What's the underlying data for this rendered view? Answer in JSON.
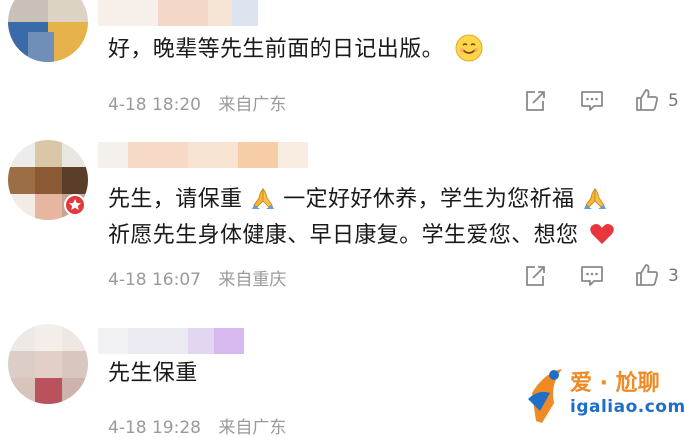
{
  "comments": [
    {
      "lines": [
        "好，晚辈等先生前面的日记出版。"
      ],
      "date": "4-18 18:20",
      "location": "来自广东",
      "likes": "5"
    },
    {
      "lines": [
        "先生，请保重",
        "一定好好休养，学生为您祈福",
        "祈愿先生身体健康、早日康复。学生爱您、想您"
      ],
      "date": "4-18 16:07",
      "location": "来自重庆",
      "likes": "3"
    },
    {
      "lines": [
        "先生保重"
      ],
      "date": "4-18 19:28",
      "location": "来自广东",
      "likes": ""
    }
  ],
  "icons": {
    "share": "share-icon",
    "comment": "comment-icon",
    "like": "thumbs-up-icon",
    "pray": "praying-hands-emoji",
    "smile": "smile-emoji",
    "heart": "red-heart-emoji"
  },
  "watermark": {
    "brand": "爱 · 尬聊",
    "url": "igaliao.com"
  },
  "colors": {
    "meta_text": "#9a9a9a",
    "icon_stroke": "#8a8a8a",
    "heart": "#e8363c",
    "watermark_orange": "#f08a24",
    "watermark_blue": "#1f6fc9"
  }
}
